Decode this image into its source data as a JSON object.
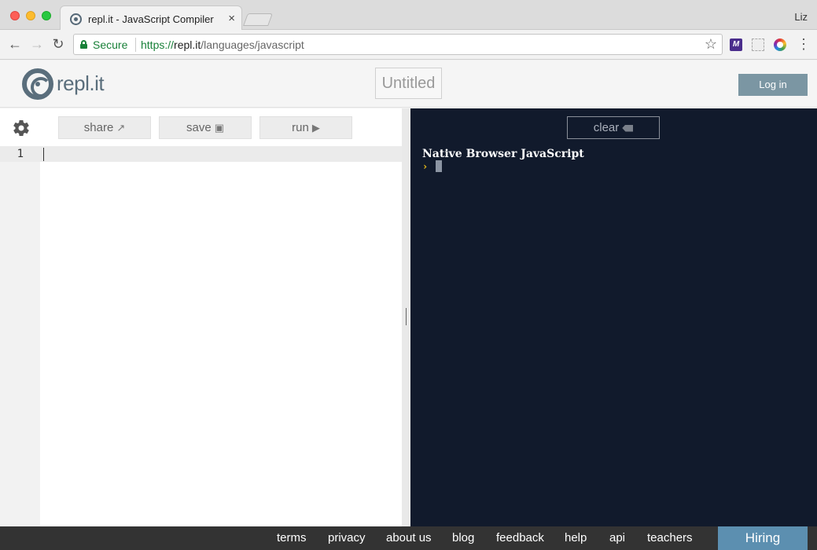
{
  "browser": {
    "tab_title": "repl.it - JavaScript Compiler",
    "tab_close": "×",
    "profile_name": "Liz",
    "secure_label": "Secure",
    "url_scheme": "https://",
    "url_host": "repl.it",
    "url_path": "/languages/javascript",
    "icons": [
      "back-arrow",
      "forward-arrow",
      "reload",
      "lock",
      "star",
      "menu"
    ]
  },
  "header": {
    "logo_text": "repl.it",
    "project_title": "Untitled",
    "login_label": "Log in"
  },
  "editor": {
    "share_label": "share",
    "save_label": "save",
    "run_label": "run",
    "line_numbers": [
      "1"
    ],
    "code": ""
  },
  "console": {
    "clear_label": "clear",
    "banner": "Native Browser JavaScript",
    "prompt": "›"
  },
  "footer": {
    "links": [
      "terms",
      "privacy",
      "about us",
      "blog",
      "feedback",
      "help",
      "api",
      "teachers"
    ],
    "hiring_label": "Hiring"
  },
  "colors": {
    "console_bg": "#111a2c",
    "brand": "#5a6e7c",
    "login_bg": "#7b96a3",
    "hiring_bg": "#5c8fb0",
    "prompt": "#f5c518"
  }
}
